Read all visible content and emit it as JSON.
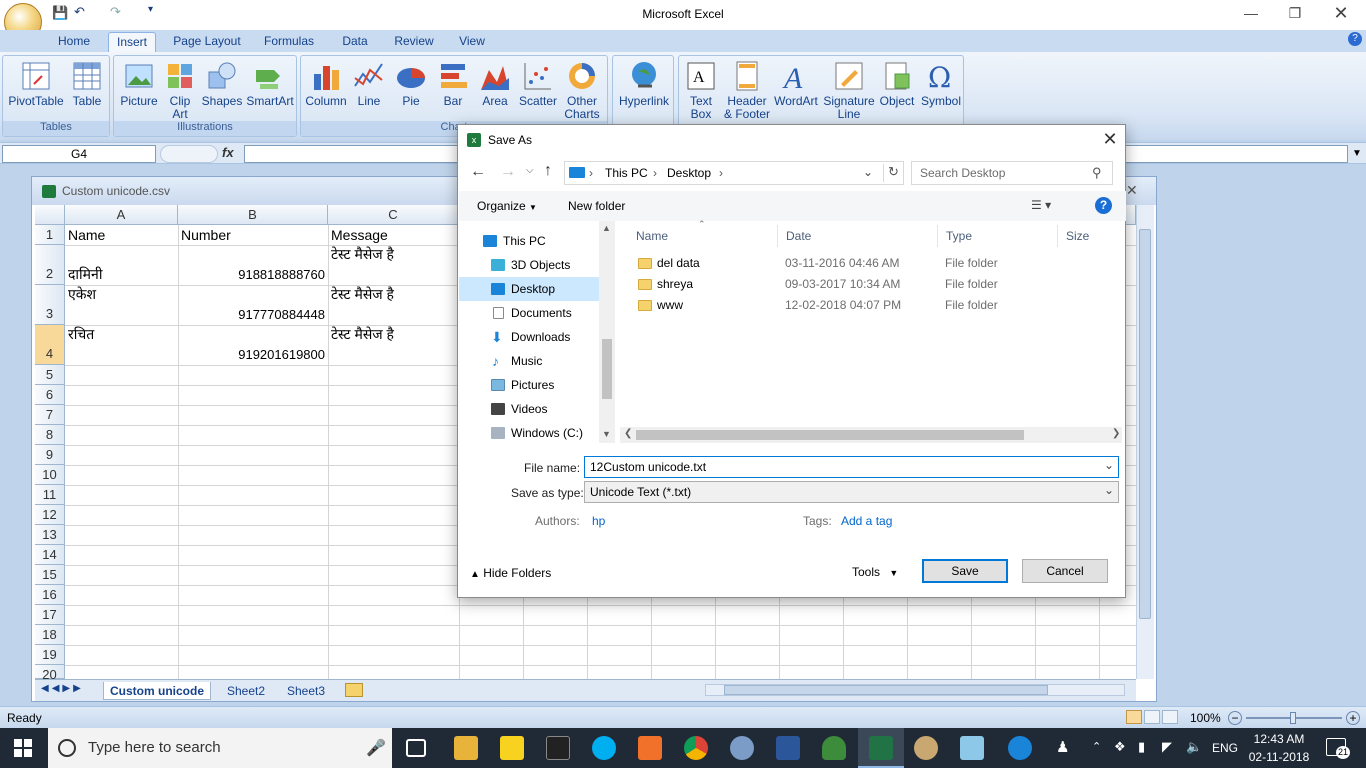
{
  "app": {
    "title": "Microsoft Excel"
  },
  "tabs": [
    "Home",
    "Insert",
    "Page Layout",
    "Formulas",
    "Data",
    "Review",
    "View"
  ],
  "ribbon": {
    "groups": {
      "tables": "Tables",
      "illustrations": "Illustrations",
      "charts": "Chart"
    },
    "buttons": {
      "pivottable": "PivotTable",
      "table": "Table",
      "picture": "Picture",
      "clipart": "Clip Art",
      "shapes": "Shapes",
      "smartart": "SmartArt",
      "column": "Column",
      "line": "Line",
      "pie": "Pie",
      "bar": "Bar",
      "area": "Area",
      "scatter": "Scatter",
      "othercharts": "Other Charts",
      "hyperlink": "Hyperlink",
      "textbox": "Text Box",
      "headerfooter": "Header & Footer",
      "wordart": "WordArt",
      "signature": "Signature Line",
      "object": "Object",
      "symbol": "Symbol"
    }
  },
  "formula_bar": {
    "name_box": "G4",
    "fx": "fx",
    "value": ""
  },
  "workbook": {
    "title": "Custom unicode.csv",
    "columns": [
      "A",
      "B",
      "C"
    ],
    "rows": [
      "1",
      "2",
      "3",
      "4",
      "5",
      "6",
      "7",
      "8",
      "9",
      "10",
      "11",
      "12",
      "13",
      "14",
      "15",
      "16",
      "17",
      "18",
      "19",
      "20"
    ],
    "cells": {
      "a1": "Name",
      "b1": "Number",
      "c1": "Message",
      "a2": "दामिनी",
      "b2": "918818888760",
      "c2": "टेस्ट मैसेज है",
      "a3": "एकेश",
      "b3": "917770884448",
      "c3": "टेस्ट मैसेज है",
      "a4": "रचित",
      "b4": "919201619800",
      "c4": "टेस्ट मैसेज है"
    },
    "sheets": [
      "Custom unicode",
      "Sheet2",
      "Sheet3"
    ]
  },
  "status": {
    "ready": "Ready",
    "zoom": "100%"
  },
  "dialog": {
    "title": "Save As",
    "breadcrumb": [
      "This PC",
      "Desktop"
    ],
    "search_placeholder": "Search Desktop",
    "organize": "Organize",
    "new_folder": "New folder",
    "nav": [
      "This PC",
      "3D Objects",
      "Desktop",
      "Documents",
      "Downloads",
      "Music",
      "Pictures",
      "Videos",
      "Windows (C:)"
    ],
    "headers": [
      "Name",
      "Date",
      "Type",
      "Size"
    ],
    "files": [
      {
        "name": "del data",
        "date": "03-11-2016 04:46 AM",
        "type": "File folder"
      },
      {
        "name": "shreya",
        "date": "09-03-2017 10:34 AM",
        "type": "File folder"
      },
      {
        "name": "www",
        "date": "12-02-2018 04:07 PM",
        "type": "File folder"
      }
    ],
    "file_name_label": "File name:",
    "file_name": "12Custom unicode.txt",
    "save_type_label": "Save as type:",
    "save_type": "Unicode Text (*.txt)",
    "authors_label": "Authors:",
    "authors": "hp",
    "tags_label": "Tags:",
    "tags": "Add a tag",
    "hide_folders": "Hide Folders",
    "tools": "Tools",
    "save": "Save",
    "cancel": "Cancel"
  },
  "taskbar": {
    "search": "Type here to search",
    "lang": "ENG",
    "time": "12:43 AM",
    "date": "02-11-2018",
    "notif": "21"
  }
}
